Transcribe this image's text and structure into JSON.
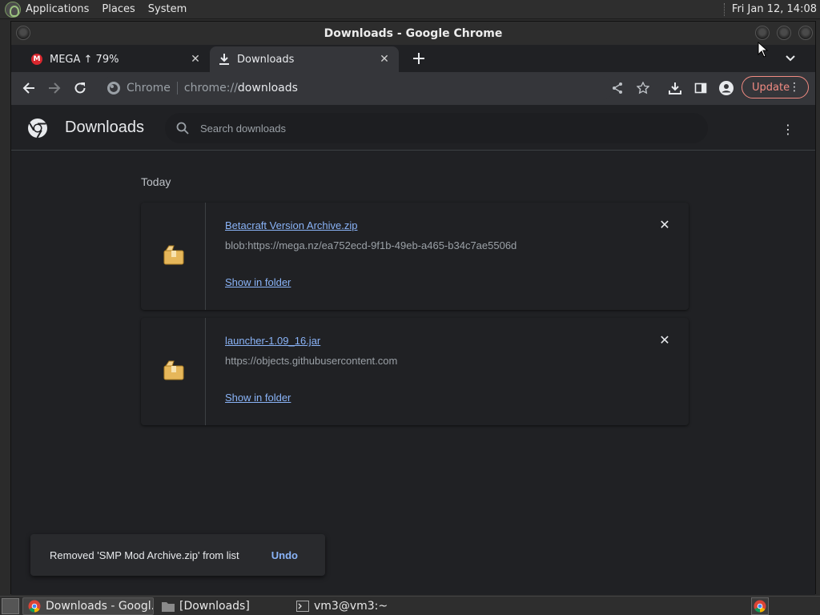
{
  "system_panel": {
    "menus": [
      "Applications",
      "Places",
      "System"
    ],
    "clock": "Fri Jan 12, 14:08"
  },
  "window": {
    "title": "Downloads - Google Chrome"
  },
  "tabs": [
    {
      "title": "MEGA ↑ 79%",
      "favicon": "mega-icon"
    },
    {
      "title": "Downloads",
      "favicon": "download-icon",
      "active": true
    }
  ],
  "toolbar": {
    "omnibox_chip": "Chrome",
    "url_scheme": "chrome://",
    "url_host": "downloads",
    "update_label": "Update"
  },
  "downloads_page": {
    "title": "Downloads",
    "search_placeholder": "Search downloads",
    "section_label": "Today",
    "items": [
      {
        "name": "Betacraft Version Archive.zip",
        "url": "blob:https://mega.nz/ea752ecd-9f1b-49eb-a465-b34c7ae5506d",
        "action": "Show in folder"
      },
      {
        "name": "launcher-1.09_16.jar",
        "url": "https://objects.githubusercontent.com",
        "action": "Show in folder"
      }
    ],
    "toast": {
      "message": "Removed 'SMP Mod Archive.zip' from list",
      "action": "Undo"
    }
  },
  "taskbar": {
    "tasks": [
      {
        "label": "Downloads - Googl...",
        "icon": "chrome-icon",
        "active": true
      },
      {
        "label": "[Downloads]",
        "icon": "folder-icon",
        "active": false
      },
      {
        "label": "vm3@vm3:~",
        "icon": "terminal-icon",
        "active": false
      }
    ]
  },
  "colors": {
    "accent_link": "#8ab4f8",
    "update_red": "#f28b82",
    "page_bg": "#202124"
  }
}
